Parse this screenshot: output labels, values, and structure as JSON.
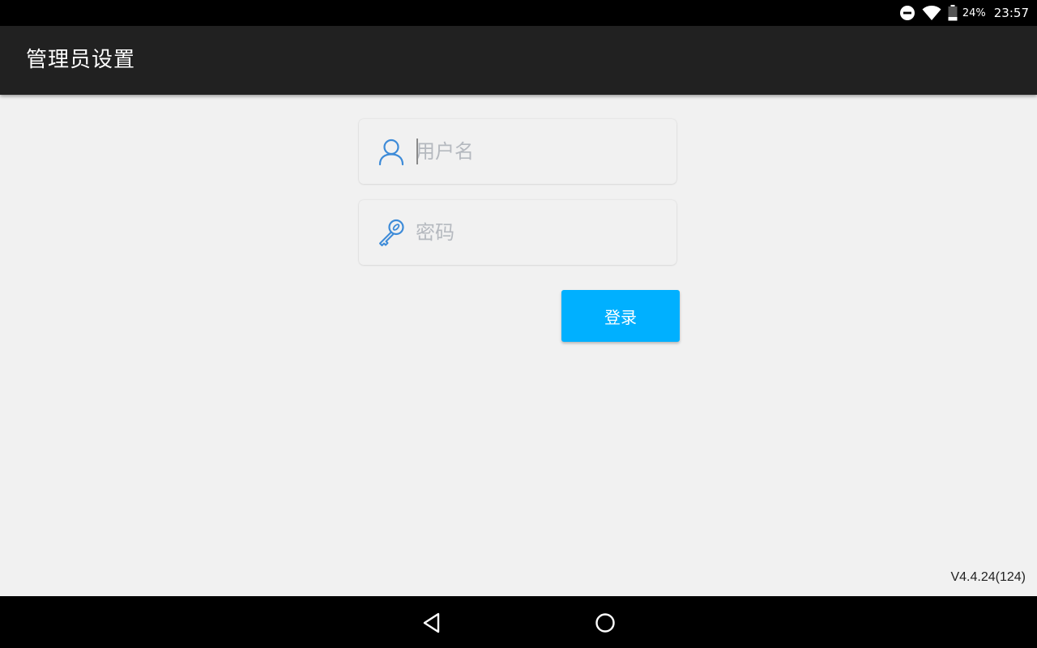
{
  "status_bar": {
    "icons": [
      "do-not-disturb-icon",
      "wifi-icon",
      "battery-icon"
    ],
    "battery": "24%",
    "time": "23:57"
  },
  "app_bar": {
    "title": "管理员设置"
  },
  "login_form": {
    "username": {
      "icon": "user-icon",
      "placeholder": "用户名",
      "value": ""
    },
    "password": {
      "icon": "key-icon",
      "placeholder": "密码",
      "value": ""
    },
    "login_label": "登录"
  },
  "version": "V4.4.24(124)",
  "nav_bar": {
    "icons": [
      "back-icon",
      "home-icon"
    ]
  },
  "colors": {
    "status_bar": "#000000",
    "app_bar": "#212121",
    "background": "#f1f1f1",
    "accent": "#00b0ff",
    "icon_blue": "#3d8bd8",
    "placeholder": "#b5b9bf"
  }
}
